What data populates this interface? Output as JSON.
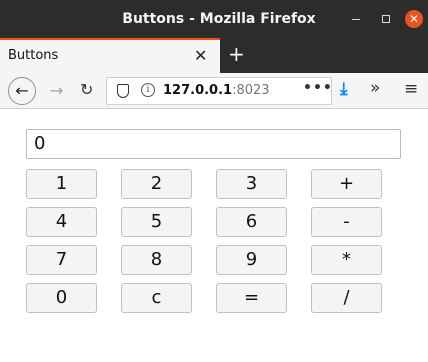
{
  "window": {
    "title": "Buttons - Mozilla Firefox",
    "minimize_icon": "minimize-icon",
    "maximize_icon": "maximize-icon",
    "close_icon": "close-icon",
    "close_glyph": "✕",
    "accent_color": "#e95420"
  },
  "tab": {
    "label": "Buttons",
    "close_glyph": "✕",
    "new_tab_glyph": "+"
  },
  "nav": {
    "back_glyph": "←",
    "forward_glyph": "→",
    "reload_glyph": "↻",
    "url_host": "127.0.0.1",
    "url_port": ":8023",
    "more_glyph": "•••",
    "download_glyph": "⤓",
    "overflow_glyph": "»",
    "menu_glyph": "≡",
    "info_glyph": "i"
  },
  "calculator": {
    "display_value": "0",
    "buttons": [
      [
        "1",
        "2",
        "3",
        "+"
      ],
      [
        "4",
        "5",
        "6",
        "-"
      ],
      [
        "7",
        "8",
        "9",
        "*"
      ],
      [
        "0",
        "c",
        "=",
        "/"
      ]
    ]
  }
}
